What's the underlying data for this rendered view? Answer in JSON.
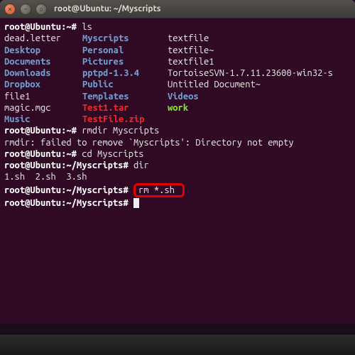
{
  "window": {
    "title": "root@Ubuntu: ~/Myscripts"
  },
  "prompts": {
    "home": "root@Ubuntu:~#",
    "myscripts": "root@Ubuntu:~/Myscripts#"
  },
  "commands": {
    "ls": "ls",
    "rmdir": "rmdir Myscripts",
    "cd": "cd Myscripts",
    "dir": "dir",
    "rm": "rm *.sh"
  },
  "ls_output": {
    "rows": [
      [
        "dead.letter",
        "Myscripts",
        "textfile"
      ],
      [
        "Desktop",
        "Personal",
        "textfile~"
      ],
      [
        "Documents",
        "Pictures",
        "textfile1"
      ],
      [
        "Downloads",
        "pptpd-1.3.4",
        "TortoiseSVN-1.7.11.23600-win32-s"
      ],
      [
        "Dropbox",
        "Public",
        "Untitled Document~"
      ],
      [
        "file1",
        "Templates",
        "Videos"
      ],
      [
        "magic.mgc",
        "Test1.tar",
        "work"
      ],
      [
        "Music",
        "TestFile.zip",
        ""
      ]
    ],
    "classes": [
      [
        "plain",
        "dir",
        "plain"
      ],
      [
        "dir",
        "dir",
        "plain"
      ],
      [
        "dir",
        "dir",
        "plain"
      ],
      [
        "dir",
        "dir",
        "plain"
      ],
      [
        "dir",
        "dir",
        "plain"
      ],
      [
        "plain",
        "dir",
        "dir"
      ],
      [
        "plain",
        "archive",
        "exec"
      ],
      [
        "dir",
        "archive",
        "plain"
      ]
    ]
  },
  "messages": {
    "rmdir_fail": "rmdir: failed to remove `Myscripts': Directory not empty"
  },
  "dir_output": "1.sh  2.sh  3.sh"
}
